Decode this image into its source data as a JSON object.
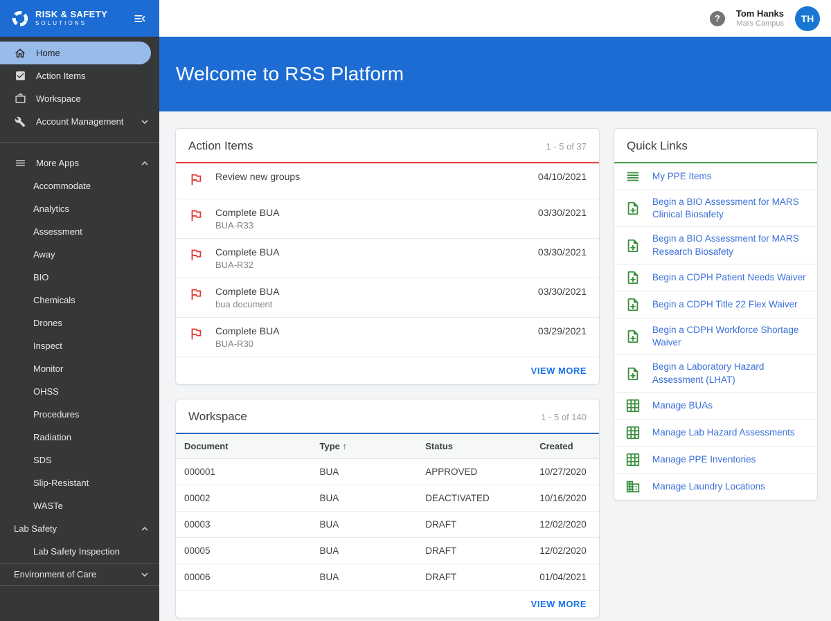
{
  "sidebar": {
    "logo_line1": "RISK & SAFETY",
    "logo_line2": "SOLUTIONS",
    "items": {
      "home": "Home",
      "action_items": "Action Items",
      "workspace": "Workspace",
      "account_management": "Account Management"
    },
    "more_apps": {
      "label": "More Apps",
      "children": [
        "Accommodate",
        "Analytics",
        "Assessment",
        "Away",
        "BIO",
        "Chemicals",
        "Drones",
        "Inspect",
        "Monitor",
        "OHSS",
        "Procedures",
        "Radiation",
        "SDS",
        "Slip-Resistant",
        "WASTe"
      ]
    },
    "lab_safety": {
      "label": "Lab Safety",
      "children": [
        "Lab Safety Inspection"
      ]
    },
    "environment_of_care": {
      "label": "Environment of Care"
    }
  },
  "topbar": {
    "help_glyph": "?",
    "user_name": "Tom Hanks",
    "user_location": "Mars Campus",
    "avatar_initials": "TH"
  },
  "banner": {
    "title": "Welcome to RSS Platform"
  },
  "action_items": {
    "title": "Action Items",
    "count": "1 - 5 of 37",
    "items": [
      {
        "title": "Review new groups",
        "subtitle": "",
        "date": "04/10/2021"
      },
      {
        "title": "Complete BUA",
        "subtitle": "BUA-R33",
        "date": "03/30/2021"
      },
      {
        "title": "Complete BUA",
        "subtitle": "BUA-R32",
        "date": "03/30/2021"
      },
      {
        "title": "Complete BUA",
        "subtitle": "bua document",
        "date": "03/30/2021"
      },
      {
        "title": "Complete BUA",
        "subtitle": "BUA-R30",
        "date": "03/29/2021"
      }
    ],
    "view_more": "VIEW MORE"
  },
  "workspace": {
    "title": "Workspace",
    "count": "1 - 5 of 140",
    "columns": [
      "Document",
      "Type",
      "Status",
      "Created"
    ],
    "sort_indicator": "↑",
    "rows": [
      [
        "000001",
        "BUA",
        "APPROVED",
        "10/27/2020"
      ],
      [
        "00002",
        "BUA",
        "DEACTIVATED",
        "10/16/2020"
      ],
      [
        "00003",
        "BUA",
        "DRAFT",
        "12/02/2020"
      ],
      [
        "00005",
        "BUA",
        "DRAFT",
        "12/02/2020"
      ],
      [
        "00006",
        "BUA",
        "DRAFT",
        "01/04/2021"
      ]
    ],
    "view_more": "VIEW MORE"
  },
  "quick_links": {
    "title": "Quick Links",
    "links": [
      {
        "icon": "list-icon",
        "label": "My PPE Items"
      },
      {
        "icon": "note-add-icon",
        "label": "Begin a BIO Assessment for MARS Clinical Biosafety"
      },
      {
        "icon": "note-add-icon",
        "label": "Begin a BIO Assessment for MARS Research Biosafety"
      },
      {
        "icon": "note-add-icon",
        "label": "Begin a CDPH Patient Needs Waiver"
      },
      {
        "icon": "note-add-icon",
        "label": "Begin a CDPH Title 22 Flex Waiver"
      },
      {
        "icon": "note-add-icon",
        "label": "Begin a CDPH Workforce Shortage Waiver"
      },
      {
        "icon": "note-add-icon",
        "label": "Begin a Laboratory Hazard Assessment (LHAT)"
      },
      {
        "icon": "grid-icon",
        "label": "Manage BUAs"
      },
      {
        "icon": "grid-icon",
        "label": "Manage Lab Hazard Assessments"
      },
      {
        "icon": "grid-icon",
        "label": "Manage PPE Inventories"
      },
      {
        "icon": "building-icon",
        "label": "Manage Laundry Locations"
      }
    ]
  },
  "colors": {
    "primary_blue": "#1c6cd3",
    "avatar_blue": "#1976d2",
    "sidebar_bg": "#363739",
    "active_item_bg": "#98bce9",
    "link_blue": "#3a6fd8",
    "view_more_blue": "#1a73e8",
    "action_accent_red": "#e5433f",
    "workspace_accent_blue": "#2a66c6",
    "quicklinks_accent_green": "#43a047",
    "icon_green": "#388e3c",
    "flag_red": "#e53935"
  }
}
